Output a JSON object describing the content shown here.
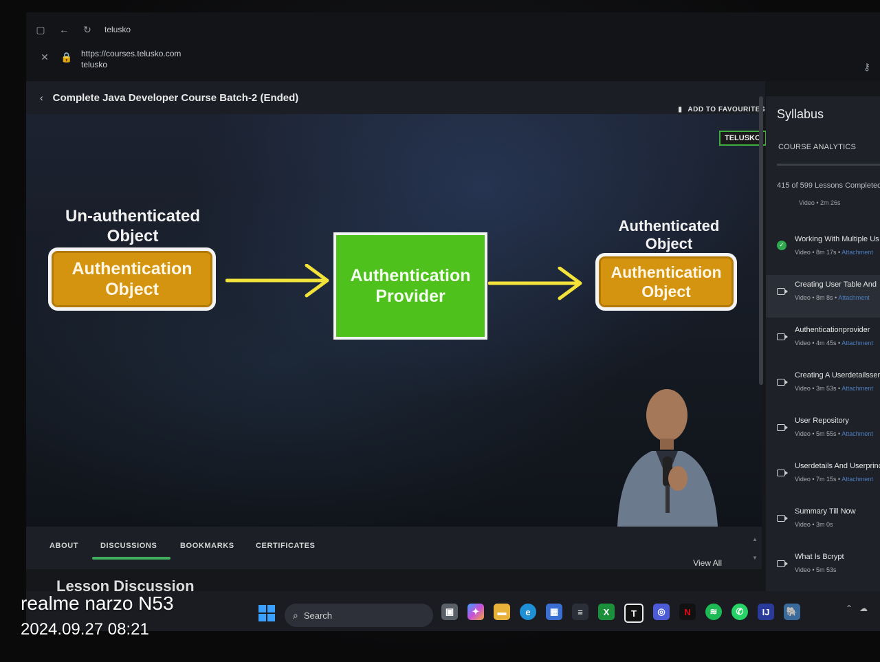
{
  "browser": {
    "tab_title": "telusko",
    "url": "https://courses.telusko.com",
    "site_name": "telusko"
  },
  "course": {
    "title": "Complete Java Developer Course Batch-2 (Ended)",
    "favourites_label": "ADD TO FAVOURITES"
  },
  "video": {
    "badge": "TELUSKO",
    "left_label": "Un-authenticated Object",
    "left_box": "Authentication Object",
    "middle_box": "Authentication Provider",
    "right_label": "Authenticated Object",
    "right_box": "Authentication Object",
    "colors": {
      "object_box": "#d4940f",
      "provider_box": "#4ec11c",
      "arrow": "#f2e23a"
    }
  },
  "tabs": [
    {
      "label": "ABOUT"
    },
    {
      "label": "DISCUSSIONS",
      "active": true
    },
    {
      "label": "BOOKMARKS"
    },
    {
      "label": "CERTIFICATES"
    }
  ],
  "view_all": "View All",
  "lesson_discussion": "Lesson Discussion",
  "sidebar": {
    "title": "Syllabus",
    "analytics": "COURSE ANALYTICS",
    "progress": "415 of 599 Lessons Completed",
    "top_meta": "Video • 2m 26s",
    "lessons": [
      {
        "title": "Working With Multiple Us",
        "meta": "Video • 8m 17s •",
        "attachment": "Attachment",
        "icon": "check-icon"
      },
      {
        "title": "Creating User Table And",
        "meta": "Video • 8m 8s •",
        "attachment": "Attachment",
        "icon": "video-icon",
        "active": true
      },
      {
        "title": "Authenticationprovider",
        "meta": "Video • 4m 45s •",
        "attachment": "Attachment",
        "icon": "video-icon"
      },
      {
        "title": "Creating A Userdetailsserv",
        "meta": "Video • 3m 53s •",
        "attachment": "Attachment",
        "icon": "video-icon"
      },
      {
        "title": "User Repository",
        "meta": "Video • 5m 55s •",
        "attachment": "Attachment",
        "icon": "video-icon"
      },
      {
        "title": "Userdetails And Userprincip",
        "meta": "Video • 7m 15s •",
        "attachment": "Attachment",
        "icon": "video-icon"
      },
      {
        "title": "Summary Till Now",
        "meta": "Video • 3m 0s",
        "attachment": "",
        "icon": "video-icon"
      },
      {
        "title": "What Is Bcrypt",
        "meta": "Video • 5m 53s",
        "attachment": "",
        "icon": "video-icon"
      }
    ]
  },
  "taskbar": {
    "search_label": "Search"
  },
  "watermark": {
    "model": "realme narzo N53",
    "datetime": "2024.09.27 08:21"
  }
}
